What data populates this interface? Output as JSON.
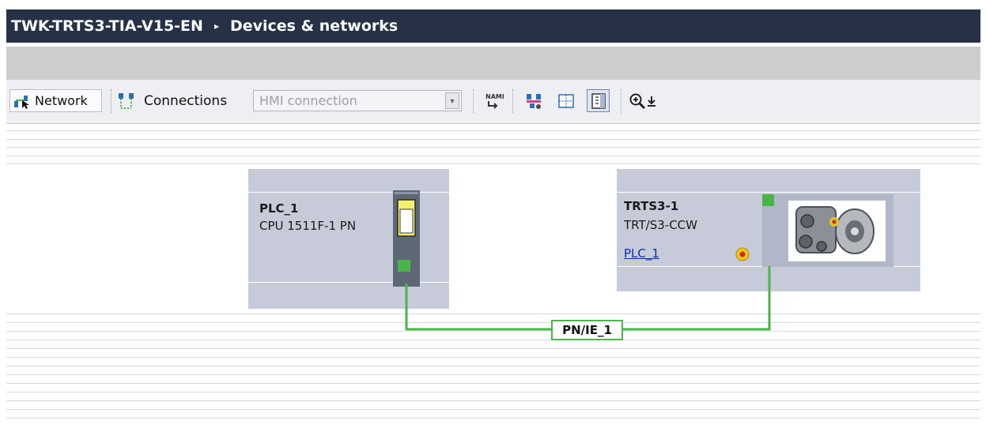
{
  "titlebar": {
    "project": "TWK-TRTS3-TIA-V15-EN",
    "separator": "▸",
    "editor": "Devices & networks"
  },
  "toolbar": {
    "network_label": "Network",
    "connections_label": "Connections",
    "connection_type": {
      "selected": "HMI connection"
    },
    "icons": [
      "network-view-icon",
      "connections-icon",
      "show-names-icon",
      "highlight-connections-icon",
      "grid-icon",
      "page-break-icon",
      "zoom-in-icon",
      "zoom-menu-icon"
    ]
  },
  "devices": [
    {
      "name": "PLC_1",
      "type": "CPU 1511F-1 PN"
    },
    {
      "name": "TRTS3-1",
      "type": "TRT/S3-CCW",
      "assigned_controller": "PLC_1"
    }
  ],
  "subnet": {
    "name": "PN/IE_1"
  },
  "colors": {
    "titlebar": "#263146",
    "device_box": "#c7cbd9",
    "profinet_line": "#49b548",
    "link_text": "#0b2ea8"
  }
}
